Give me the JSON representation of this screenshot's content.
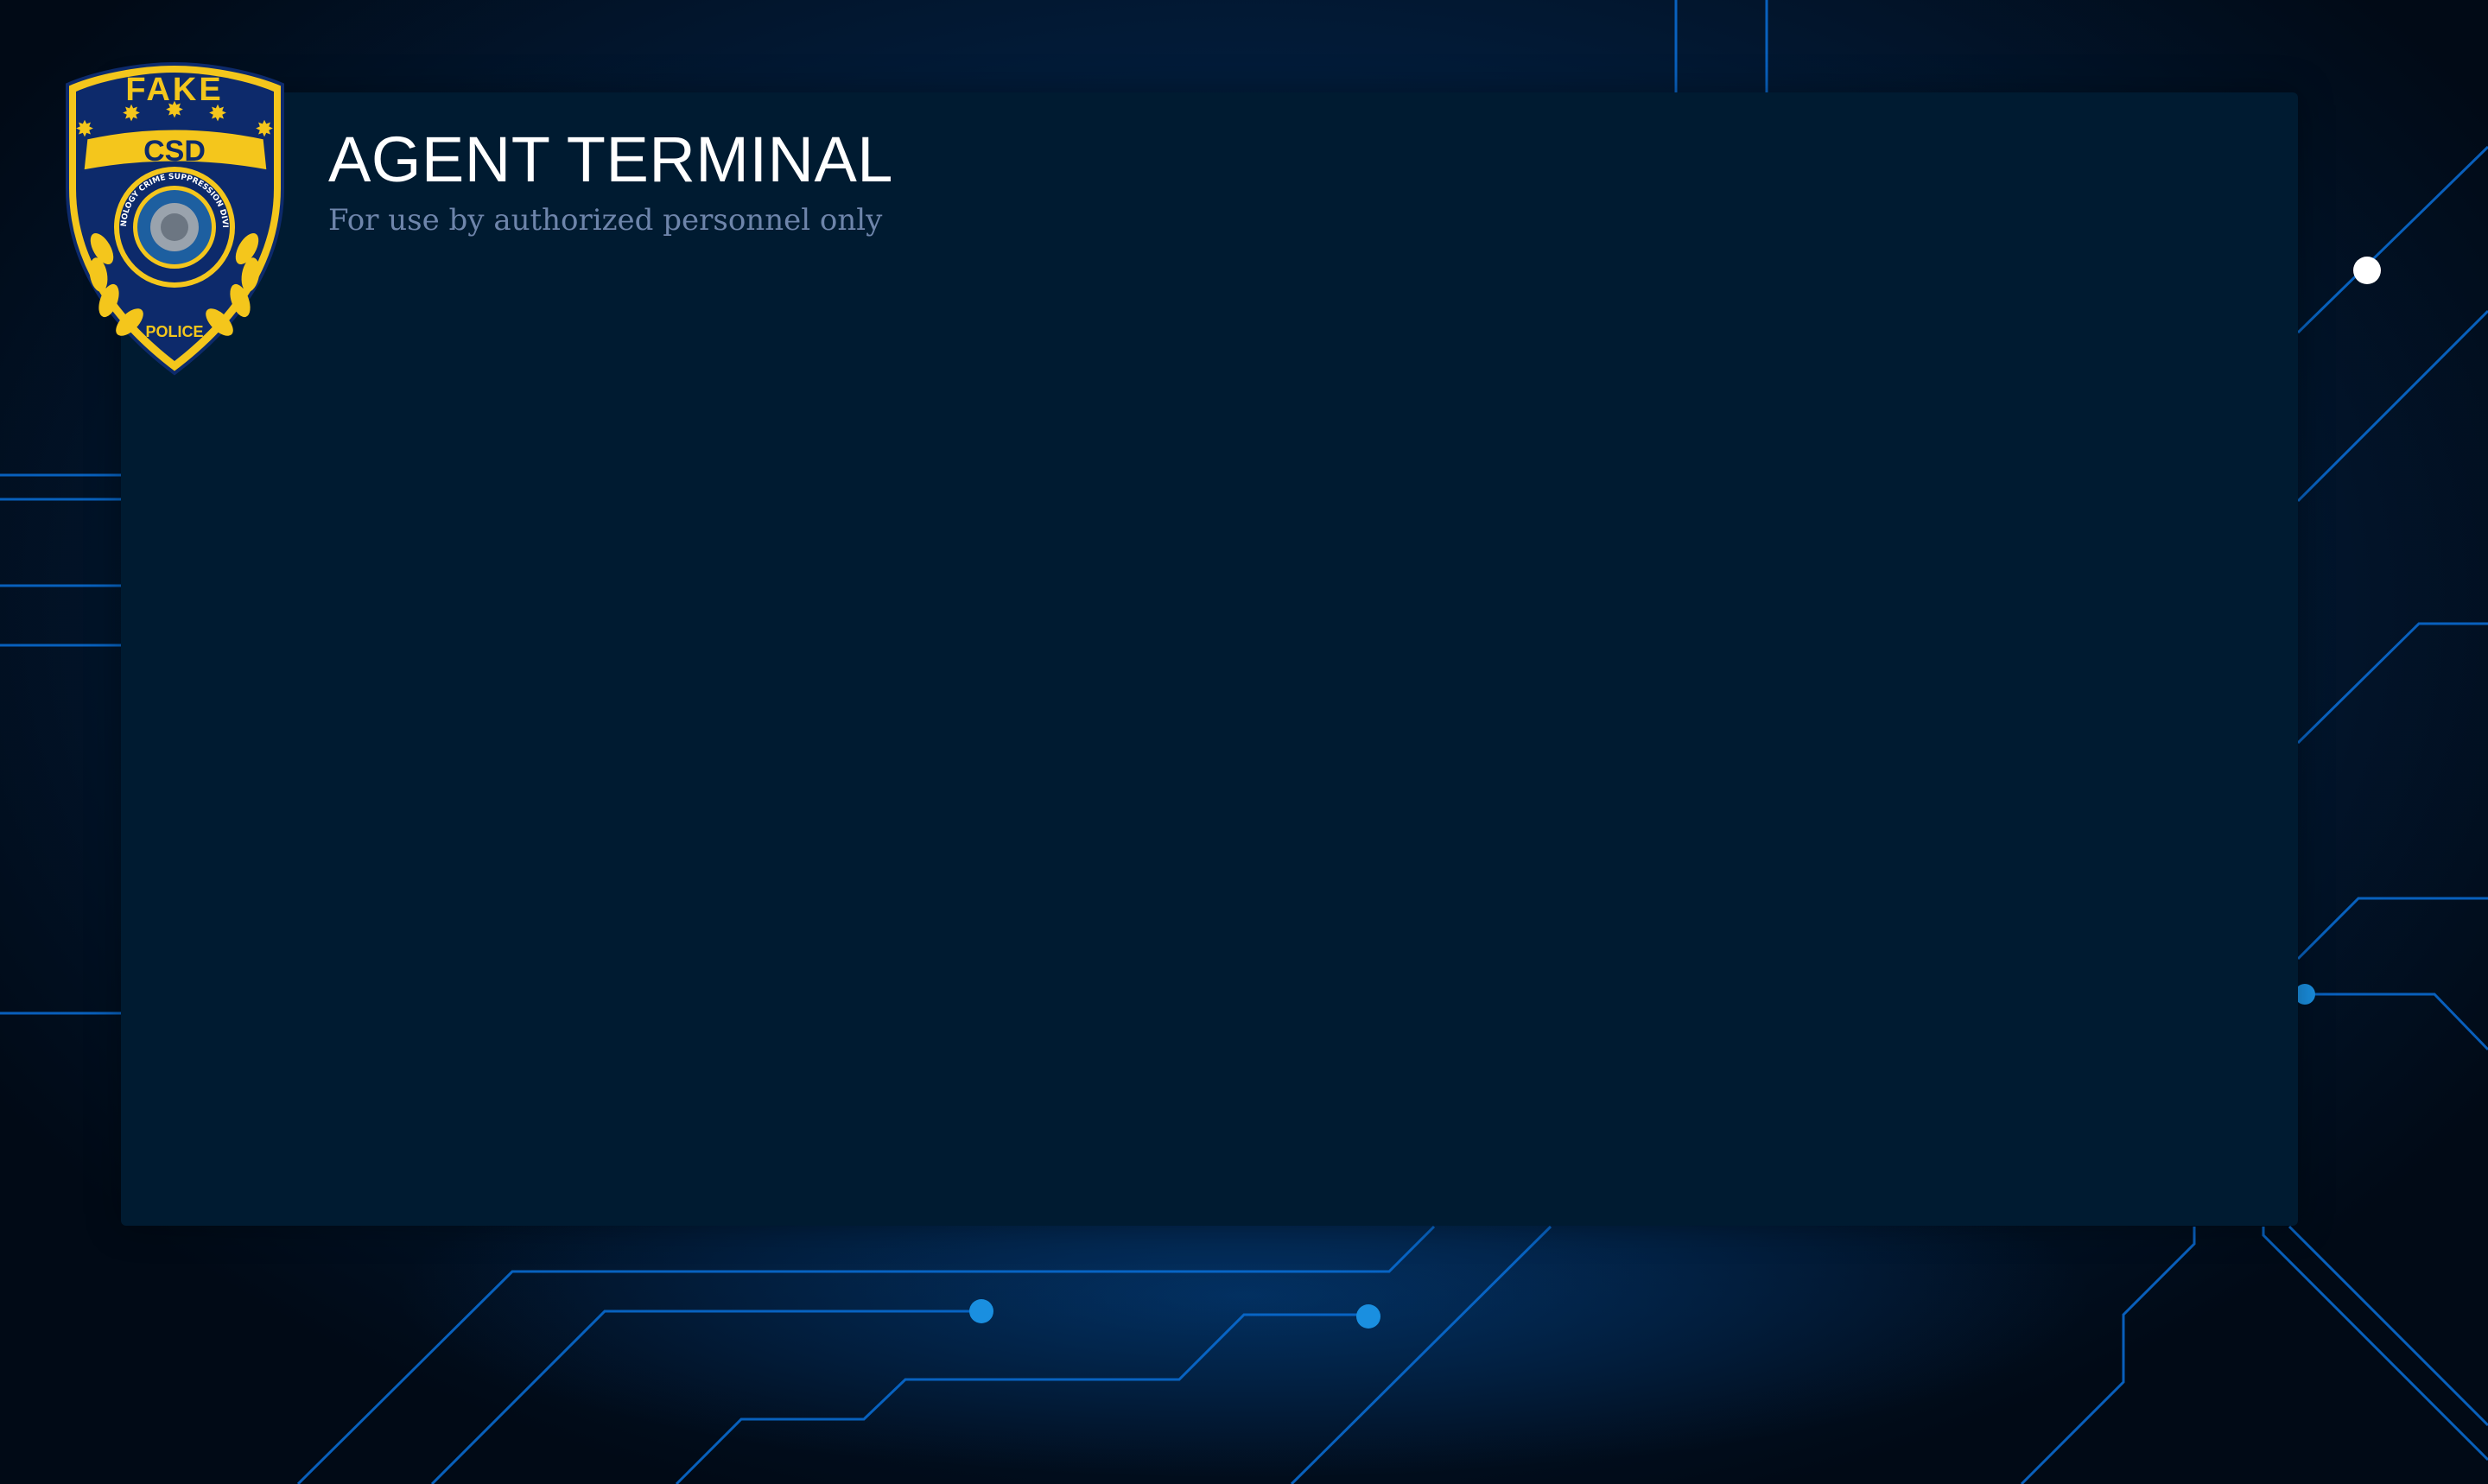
{
  "header": {
    "title": "AGENT TERMINAL",
    "subtitle": "For use by authorized personnel only"
  },
  "badge": {
    "top_text": "FAKE",
    "banner_text": "CSD",
    "ring_text": "TECHNOLOGY CRIME SUPPRESSION DIVISION",
    "bottom_text": "POLICE"
  },
  "colors": {
    "background": "#021c3a",
    "panel": "#001b31",
    "circuit_line": "#0a6fd8",
    "circuit_node": "#1a8fe0",
    "badge_gold": "#f4c61c",
    "badge_navy": "#0d2a6b",
    "subtitle": "#6e85ab"
  }
}
